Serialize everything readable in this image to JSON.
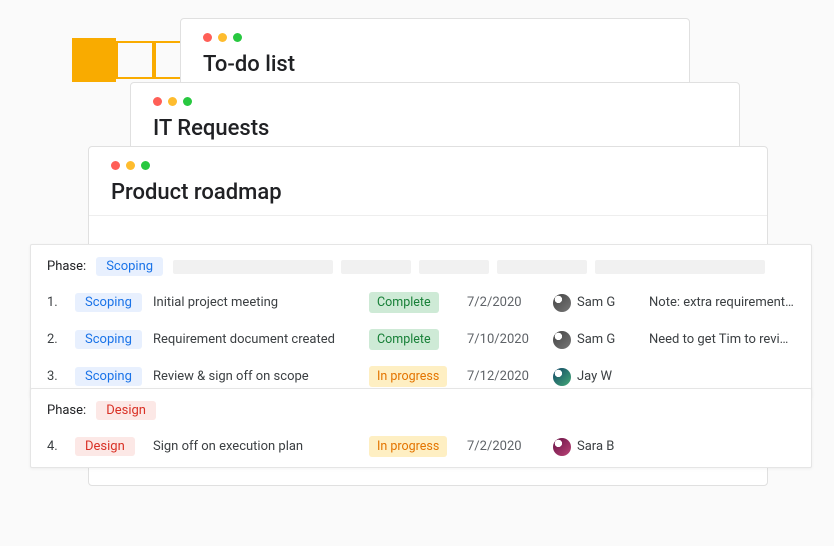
{
  "windows": {
    "todo": {
      "title": "To-do list"
    },
    "it": {
      "title": "IT Requests"
    },
    "roadmap": {
      "title": "Product roadmap"
    }
  },
  "phase_label": "Phase:",
  "phases": {
    "scoping": "Scoping",
    "design": "Design"
  },
  "status": {
    "complete": "Complete",
    "in_progress": "In progress"
  },
  "sections": [
    {
      "phase_key": "scoping",
      "rows": [
        {
          "n": "1.",
          "phase": "Scoping",
          "task": "Initial project meeting",
          "status_key": "complete",
          "date": "7/2/2020",
          "assignee": "Sam G",
          "avatar": "a1",
          "note": "Note: extra requirement to…"
        },
        {
          "n": "2.",
          "phase": "Scoping",
          "task": "Requirement document created",
          "status_key": "complete",
          "date": "7/10/2020",
          "assignee": "Sam G",
          "avatar": "a1",
          "note": "Need to get Tim to review"
        },
        {
          "n": "3.",
          "phase": "Scoping",
          "task": "Review & sign off on scope",
          "status_key": "in_progress",
          "date": "7/12/2020",
          "assignee": "Jay W",
          "avatar": "a3",
          "note": ""
        }
      ]
    },
    {
      "phase_key": "design",
      "rows": [
        {
          "n": "4.",
          "phase": "Design",
          "task": "Sign off on execution plan",
          "status_key": "in_progress",
          "date": "7/2/2020",
          "assignee": "Sara B",
          "avatar": "a2",
          "note": ""
        }
      ]
    }
  ]
}
